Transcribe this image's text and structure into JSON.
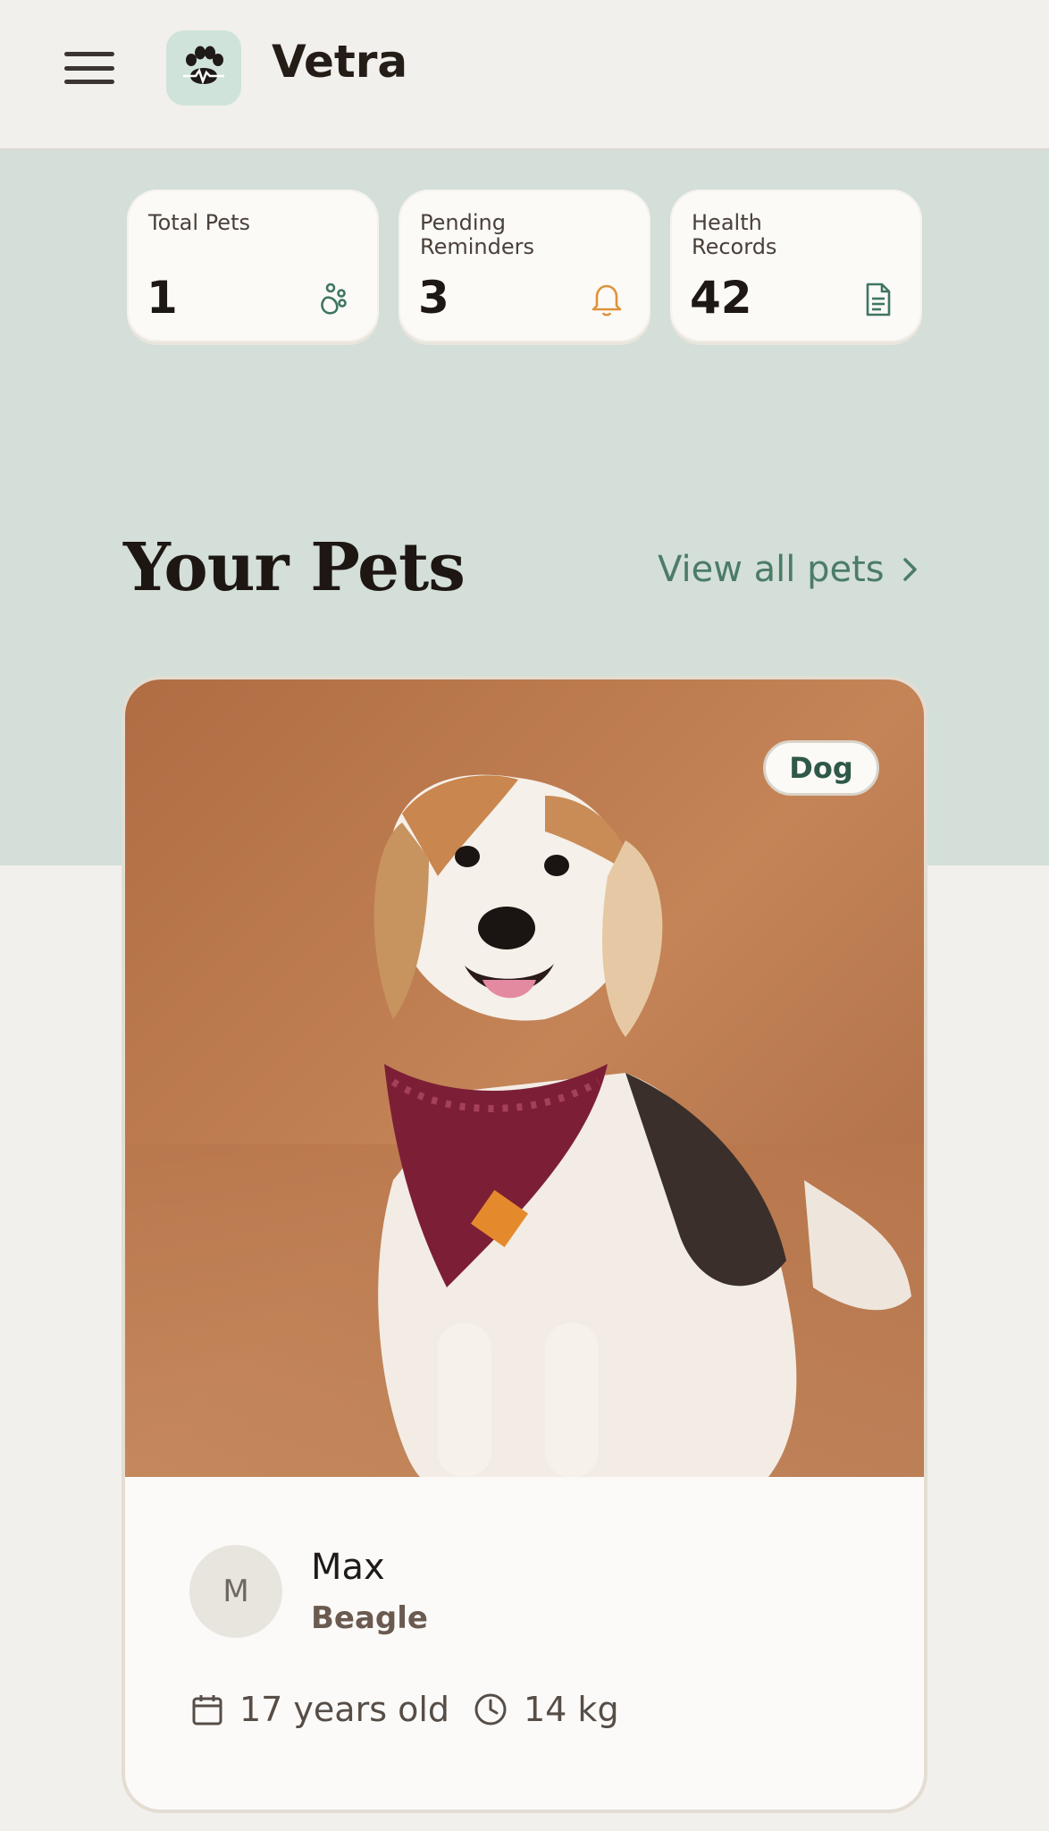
{
  "app": {
    "title": "Vetra"
  },
  "stats": [
    {
      "label": "Total Pets",
      "value": "1",
      "icon": "paw-icon",
      "color": "#3f7563"
    },
    {
      "label": "Pending Reminders",
      "value": "3",
      "icon": "bell-icon",
      "color": "#e0923a"
    },
    {
      "label": "Health Records",
      "value": "42",
      "icon": "document-icon",
      "color": "#3f7563"
    }
  ],
  "section": {
    "title": "Your Pets",
    "view_all": "View all pets"
  },
  "pet": {
    "species_badge": "Dog",
    "avatar_initial": "M",
    "name": "Max",
    "breed": "Beagle",
    "age": "17 years old",
    "weight": "14 kg"
  },
  "colors": {
    "accent": "#4c7c68",
    "hero_bg": "#d3dfd8",
    "page_bg": "#f2f0ec",
    "warning": "#e0923a"
  }
}
